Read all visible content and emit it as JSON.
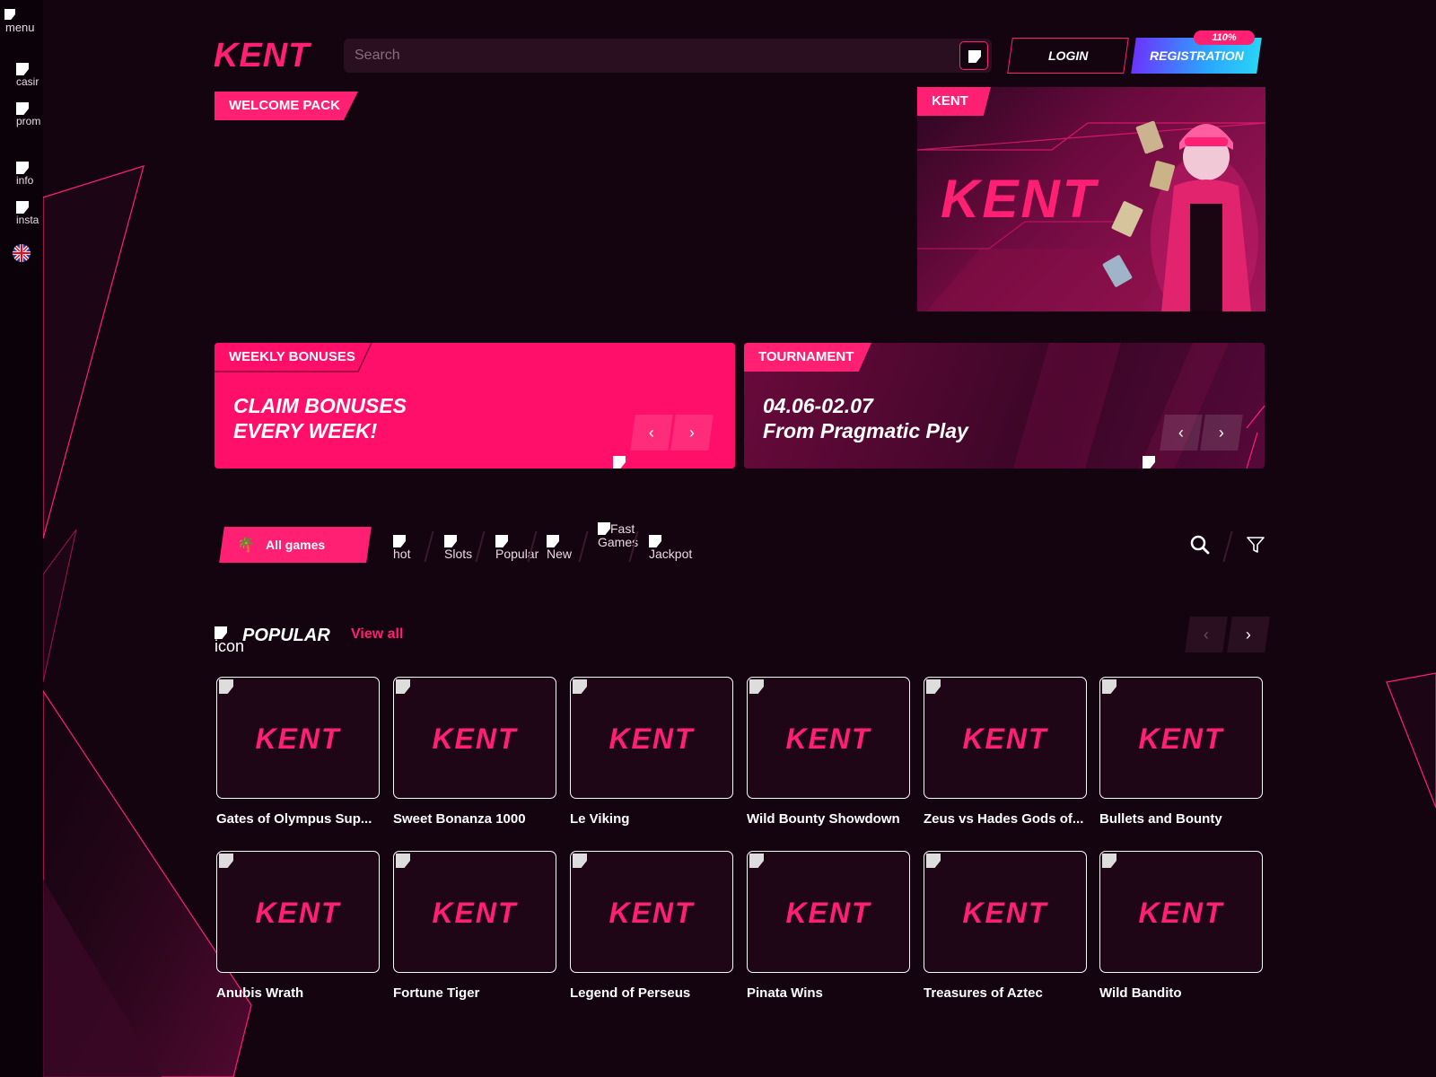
{
  "sidebar": {
    "menu_label": "menu",
    "items": [
      {
        "label": "casir"
      },
      {
        "label": "prom"
      },
      {
        "label": "info"
      },
      {
        "label": "insta"
      }
    ],
    "language_icon": "uk-flag-icon"
  },
  "header": {
    "logo": "KENT",
    "search_placeholder": "Search",
    "login_label": "LOGIN",
    "registration_label": "REGISTRATION",
    "registration_badge": "110%"
  },
  "hero": {
    "welcome_tag": "WELCOME PACK",
    "banner_tag": "KENT",
    "banner_logo": "KENT"
  },
  "promos": [
    {
      "tag": "WEEKLY BONUSES",
      "line1": "CLAIM BONUSES",
      "line2": "EVERY WEEK!"
    },
    {
      "tag": "TOURNAMENT",
      "line1": "04.06-02.07",
      "line2": "From Pragmatic Play"
    }
  ],
  "filters": {
    "all_games": "All games",
    "categories": [
      {
        "label": "hot"
      },
      {
        "label": "Slots"
      },
      {
        "label": "Popular"
      },
      {
        "label": "New"
      },
      {
        "label": "Fast Games"
      },
      {
        "label": "Jackpot"
      }
    ]
  },
  "popular": {
    "icon_label": "icon",
    "title": "POPULAR",
    "view_all": "View all",
    "games": [
      {
        "name": "Gates of Olympus Sup..."
      },
      {
        "name": "Sweet Bonanza 1000"
      },
      {
        "name": "Le Viking"
      },
      {
        "name": "Wild Bounty Showdown"
      },
      {
        "name": "Zeus vs Hades Gods of..."
      },
      {
        "name": "Bullets and Bounty"
      },
      {
        "name": "Anubis Wrath"
      },
      {
        "name": "Fortune Tiger"
      },
      {
        "name": "Legend of Perseus"
      },
      {
        "name": "Pinata Wins"
      },
      {
        "name": "Treasures of Aztec"
      },
      {
        "name": "Wild Bandito"
      }
    ],
    "thumb_logo": "KENT"
  },
  "colors": {
    "background": "#14040f",
    "accent": "#ff1f73",
    "sidebar": "#0b0209"
  }
}
